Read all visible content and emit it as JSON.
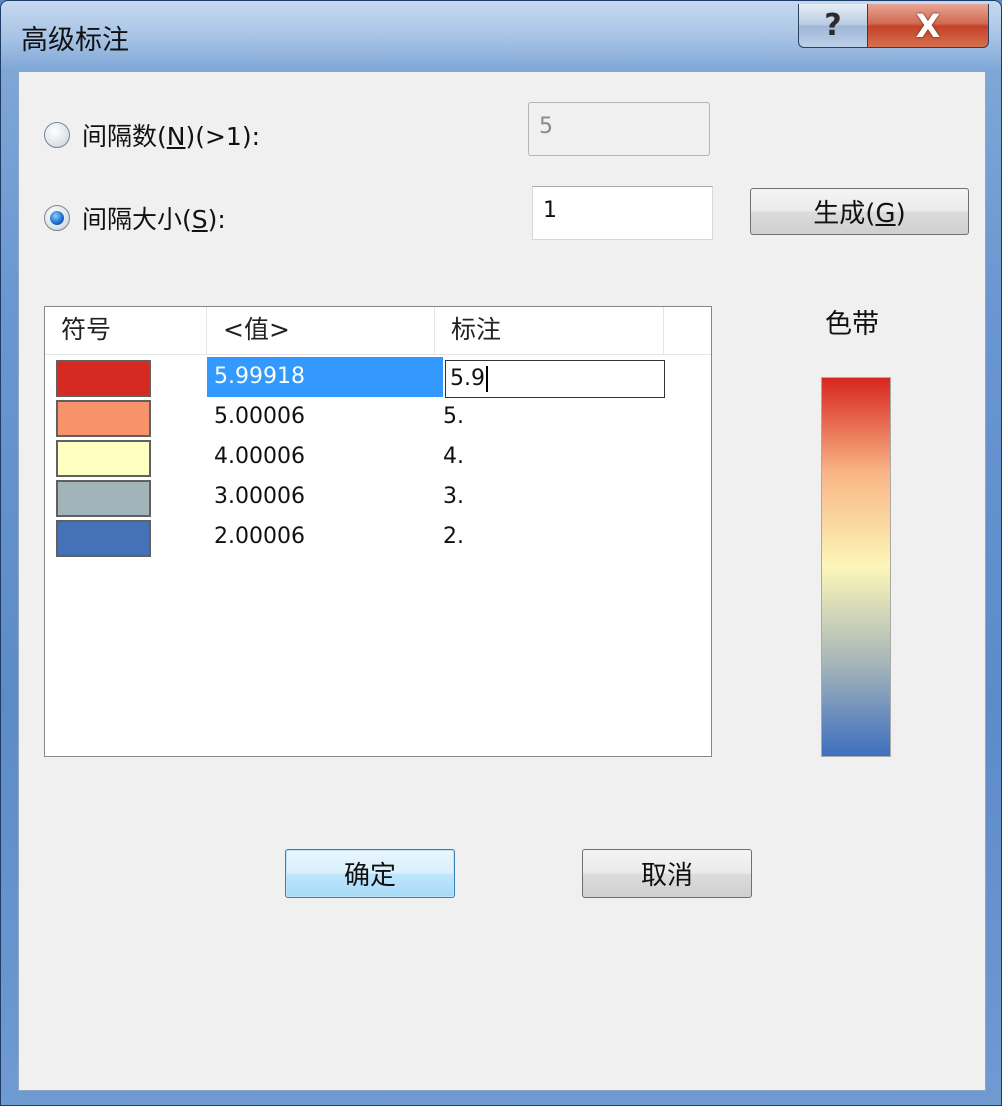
{
  "window": {
    "title": "高级标注",
    "help_label": "?",
    "close_label": "X"
  },
  "options": {
    "interval_count": {
      "label_pre": "间隔数(",
      "accel": "N",
      "label_post": ")(>1):",
      "value": "5",
      "selected": false
    },
    "interval_size": {
      "label_pre": "间隔大小(",
      "accel": "S",
      "label_post": "):",
      "value": "1",
      "selected": true
    },
    "generate_button": {
      "label_pre": "生成(",
      "accel": "G",
      "label_post": ")"
    }
  },
  "table": {
    "columns": [
      "符号",
      "<值>",
      "标注"
    ],
    "rows": [
      {
        "color": "#d42a22",
        "value": "5.99918",
        "label": "5.9",
        "selected": true,
        "editing": true
      },
      {
        "color": "#f6936a",
        "value": "5.00006",
        "label": "5."
      },
      {
        "color": "#feffc0",
        "value": "4.00006",
        "label": "4."
      },
      {
        "color": "#a2b3ba",
        "value": "3.00006",
        "label": "3."
      },
      {
        "color": "#4471b8",
        "value": "2.00006",
        "label": "2."
      }
    ]
  },
  "color_ramp": {
    "label": "色带",
    "colors": [
      "#d7261e",
      "#f9b585",
      "#fcf6b8",
      "#a8b6b8",
      "#3e6fc0"
    ]
  },
  "buttons": {
    "ok": "确定",
    "cancel": "取消"
  }
}
